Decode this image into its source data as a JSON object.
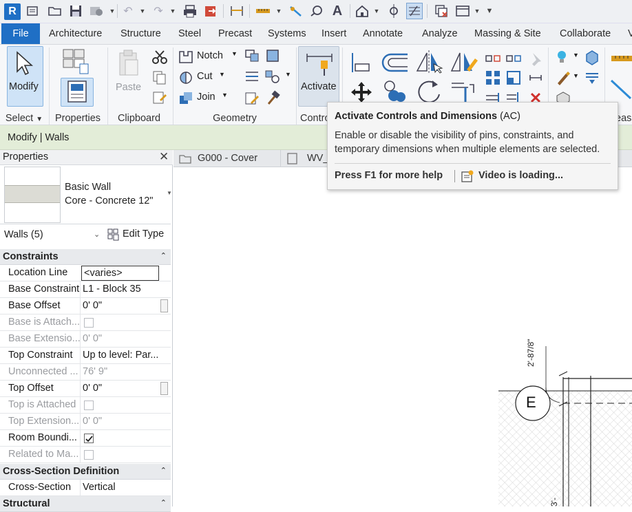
{
  "app": {
    "logo_letter": "R"
  },
  "tabs": [
    "File",
    "Architecture",
    "Structure",
    "Steel",
    "Precast",
    "Systems",
    "Insert",
    "Annotate",
    "Analyze",
    "Massing & Site",
    "Collaborate",
    "V"
  ],
  "ribbon": {
    "panels": [
      "Select",
      "Properties",
      "Clipboard",
      "Geometry",
      "Contro",
      "eas"
    ],
    "modify_label": "Modify",
    "paste_label": "Paste",
    "notch_label": "Notch",
    "cut_label": "Cut",
    "join_label": "Join",
    "activate_label": "Activate"
  },
  "context_bar": {
    "title": "Modify | Walls"
  },
  "properties": {
    "title": "Properties",
    "type_family": "Basic Wall",
    "type_name": "Core - Concrete 12\"",
    "filter": "Walls (5)",
    "edit_type": "Edit Type",
    "sections": {
      "constraints": "Constraints",
      "cross": "Cross-Section Definition",
      "structural": "Structural"
    },
    "rows": [
      {
        "label": "Location Line",
        "value": "<varies>"
      },
      {
        "label": "Base Constraint",
        "value": "L1 - Block 35"
      },
      {
        "label": "Base Offset",
        "value": "0'  0\""
      },
      {
        "label": "Base is Attach...",
        "value": ""
      },
      {
        "label": "Base Extensio...",
        "value": "0'  0\""
      },
      {
        "label": "Top Constraint",
        "value": "Up to level: Par..."
      },
      {
        "label": "Unconnected ...",
        "value": "76'  9\""
      },
      {
        "label": "Top Offset",
        "value": "0'  0\""
      },
      {
        "label": "Top is Attached",
        "value": ""
      },
      {
        "label": "Top Extension...",
        "value": "0'  0\""
      },
      {
        "label": "Room Boundi...",
        "value": ""
      },
      {
        "label": "Related to Ma...",
        "value": ""
      }
    ],
    "cross_row": {
      "label": "Cross-Section",
      "value": "Vertical"
    }
  },
  "view_tabs": [
    "G000 - Cover",
    "WV_"
  ],
  "drawing": {
    "grid_label": "E",
    "dim_text": "2'-87/8\"",
    "dim_text2": "3'-"
  },
  "tooltip": {
    "title": "Activate Controls and Dimensions",
    "shortcut": "(AC)",
    "body": "Enable or disable the visibility of pins, constraints, and temporary dimensions when multiple elements are selected.",
    "help": "Press F1 for more help",
    "video": "Video is loading..."
  },
  "colors": {
    "accent": "#1f6fc5",
    "context": "#e3edd8"
  }
}
